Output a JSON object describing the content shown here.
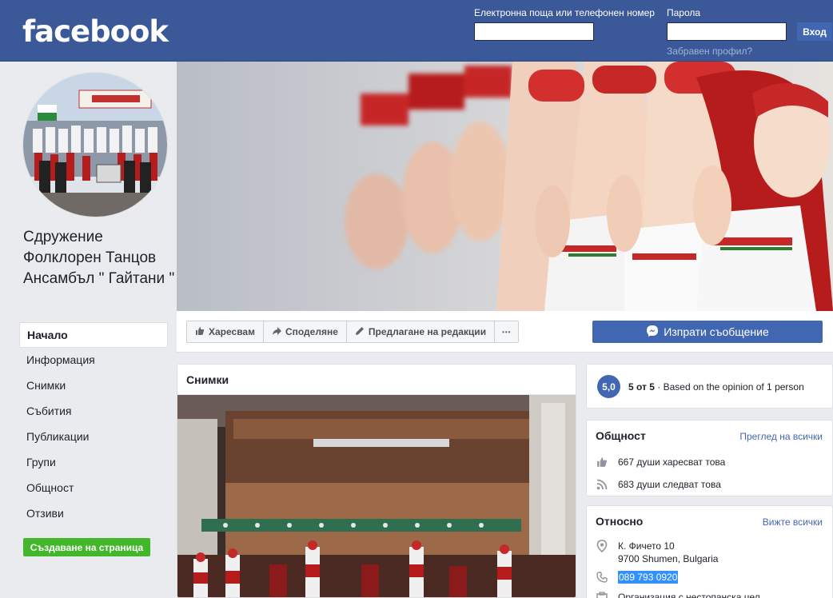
{
  "header": {
    "logo": "facebook",
    "email_label": "Електронна поща или телефонен номер",
    "password_label": "Парола",
    "login_button": "Вход",
    "forgot_link": "Забравен профил?"
  },
  "page": {
    "name": "Сдружение Фолклорен Танцов Ансамбъл \" Гайтани \""
  },
  "nav": {
    "items": [
      "Начало",
      "Информация",
      "Снимки",
      "Събития",
      "Публикации",
      "Групи",
      "Общност",
      "Отзиви"
    ],
    "create_page": "Създаване на страница"
  },
  "actions": {
    "like": "Харесвам",
    "share": "Споделяне",
    "suggest": "Предлагане на редакции",
    "more": "•••",
    "send_message": "Изпрати съобщение"
  },
  "photos": {
    "title": "Снимки"
  },
  "rating": {
    "score": "5,0",
    "out_of": "5 от 5",
    "separator": "·",
    "basis": "Based on the opinion of 1 person"
  },
  "community": {
    "title": "Общност",
    "see_all": "Преглед на всички",
    "likes": "667 души харесват това",
    "follows": "683 души следват това"
  },
  "about": {
    "title": "Относно",
    "see_all": "Вижте всички",
    "address_line1": "К. Фичето 10",
    "address_line2": "9700 Shumen, Bulgaria",
    "phone": "089 793 0920",
    "partial_text": "Организация с нестопанска цел"
  },
  "colors": {
    "brand": "#3b5998",
    "button_blue": "#4267b2",
    "green": "#42b72a",
    "page_bg": "#e9ebee"
  }
}
